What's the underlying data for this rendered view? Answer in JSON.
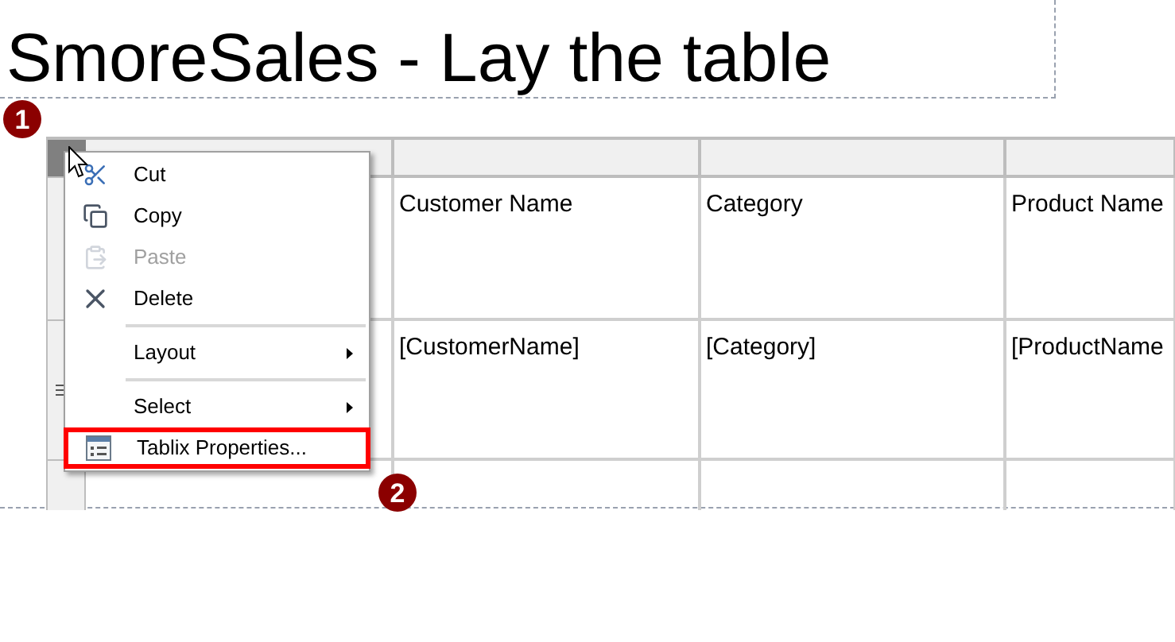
{
  "title": "SmoreSales - Lay the table",
  "table": {
    "header_row": [
      "Customer Name",
      "Category",
      "Product Name"
    ],
    "data_row": [
      "[CustomerName]",
      "[Category]",
      "[ProductName"
    ]
  },
  "context_menu": [
    {
      "kind": "item",
      "label": "Cut",
      "disabled": false,
      "submenu": false,
      "outlined": false
    },
    {
      "kind": "item",
      "label": "Copy",
      "disabled": false,
      "submenu": false,
      "outlined": false
    },
    {
      "kind": "item",
      "label": "Paste",
      "disabled": true,
      "submenu": false,
      "outlined": false
    },
    {
      "kind": "item",
      "label": "Delete",
      "disabled": false,
      "submenu": false,
      "outlined": false
    },
    {
      "kind": "separator"
    },
    {
      "kind": "item",
      "label": "Layout",
      "disabled": false,
      "submenu": true,
      "outlined": false
    },
    {
      "kind": "separator"
    },
    {
      "kind": "item",
      "label": "Select",
      "disabled": false,
      "submenu": true,
      "outlined": false
    },
    {
      "kind": "item",
      "label": "Tablix Properties...",
      "disabled": false,
      "submenu": false,
      "outlined": true
    }
  ],
  "step_badges": [
    "1",
    "2"
  ]
}
